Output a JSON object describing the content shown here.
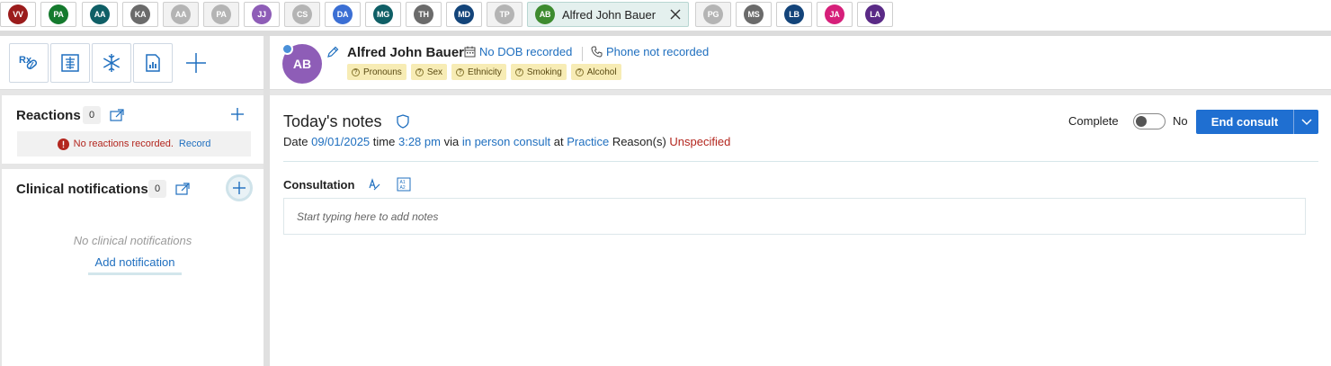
{
  "patient_tabs": [
    {
      "initials": "VV",
      "color": "#9b1c1c",
      "faded": false
    },
    {
      "initials": "PA",
      "color": "#157a2e",
      "faded": false
    },
    {
      "initials": "AA",
      "color": "#0f5f66",
      "faded": false
    },
    {
      "initials": "KA",
      "color": "#6b6b6b",
      "faded": false
    },
    {
      "initials": "AA",
      "color": "#b4b4b4",
      "faded": true
    },
    {
      "initials": "PA",
      "color": "#b4b4b4",
      "faded": true
    },
    {
      "initials": "JJ",
      "color": "#8e5db7",
      "faded": false
    },
    {
      "initials": "CS",
      "color": "#b4b4b4",
      "faded": true
    },
    {
      "initials": "DA",
      "color": "#3b6fd4",
      "faded": false
    },
    {
      "initials": "MG",
      "color": "#0f5f66",
      "faded": false
    },
    {
      "initials": "TH",
      "color": "#6b6b6b",
      "faded": false
    },
    {
      "initials": "MD",
      "color": "#13447a",
      "faded": false
    },
    {
      "initials": "TP",
      "color": "#b4b4b4",
      "faded": true
    },
    {
      "initials": "AB",
      "color": "#3d8b2f",
      "faded": false,
      "active": true,
      "name": "Alfred John Bauer"
    },
    {
      "initials": "PG",
      "color": "#b4b4b4",
      "faded": true
    },
    {
      "initials": "MS",
      "color": "#6b6b6b",
      "faded": false
    },
    {
      "initials": "LB",
      "color": "#13447a",
      "faded": false
    },
    {
      "initials": "JA",
      "color": "#d61f7a",
      "faded": false
    },
    {
      "initials": "LA",
      "color": "#5a2a86",
      "faded": false
    }
  ],
  "tools": [
    "prescription-icon",
    "medical-record-icon",
    "snowflake-icon",
    "chart-report-icon",
    "plus-icon"
  ],
  "reactions": {
    "title": "Reactions",
    "count": "0",
    "alert_text": "No reactions recorded.",
    "alert_link": "Record"
  },
  "notifications": {
    "title": "Clinical notifications",
    "count": "0",
    "empty_text": "No clinical notifications",
    "add_link": "Add notification"
  },
  "patient": {
    "initials": "AB",
    "name": "Alfred John Bauer",
    "dob": "No DOB recorded",
    "phone": "Phone not recorded",
    "tags": [
      "Pronouns",
      "Sex",
      "Ethnicity",
      "Smoking",
      "Alcohol"
    ]
  },
  "notes": {
    "title": "Today's notes",
    "date_label": "Date",
    "date": "09/01/2025",
    "time_label": "time",
    "time": "3:28 pm",
    "via_label": "via",
    "via": "in person consult",
    "at_label": "at",
    "location": "Practice",
    "reason_label": "Reason(s)",
    "reason": "Unspecified",
    "complete_label": "Complete",
    "complete_state": "No",
    "end_button": "End consult",
    "section_label": "Consultation",
    "input_placeholder": "Start typing here to add notes"
  },
  "colors": {
    "accent": "#1f6fd1",
    "link": "#1f6fbf",
    "warning": "#b3261e",
    "tag_bg": "#f7ecb5"
  }
}
